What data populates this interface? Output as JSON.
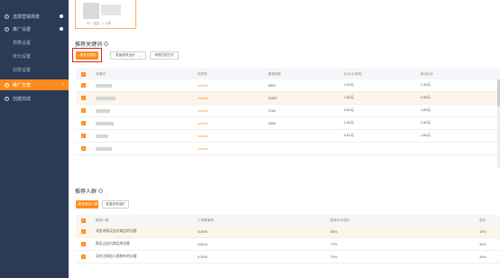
{
  "sidebar": {
    "items": [
      {
        "num": "1",
        "label": "选择营销场景"
      },
      {
        "num": "2",
        "label": "推广设置"
      },
      {
        "label": "预算设置"
      },
      {
        "label": "单元设置"
      },
      {
        "label": "创意设置"
      },
      {
        "num": "3",
        "label": "推广方案"
      },
      {
        "num": "4",
        "label": "创建完成"
      }
    ]
  },
  "top_card": {
    "caption": "¥0 · 流量 · 1 人群"
  },
  "keywords": {
    "title": "推荐关键词",
    "add_button": "更多关键词",
    "bid_select": "批量修改出价",
    "match_button": "修改匹配方式",
    "columns": [
      "关键词",
      "相关性",
      "展现指数",
      "出价(计算机)",
      "移动出价"
    ],
    "rows": [
      {
        "index": "4552",
        "pc_bid": "1.10元",
        "mobile_bid": "2.44元"
      },
      {
        "index": "11667",
        "pc_bid": "1.52元",
        "mobile_bid": "2.58元"
      },
      {
        "index": "1764",
        "pc_bid": "0.84元",
        "mobile_bid": "1.80元"
      },
      {
        "index": "2366",
        "pc_bid": "1.45元",
        "mobile_bid": "2.82元"
      },
      {
        "index": "-",
        "pc_bid": "0.81元",
        "mobile_bid": "1.84元"
      },
      {
        "index": "",
        "pc_bid": "",
        "mobile_bid": ""
      }
    ]
  },
  "crowd": {
    "title": "推荐人群",
    "add_button": "更多精选人群",
    "batch_button": "批量修改溢价",
    "columns": [
      "精选人群",
      "人群覆盖率",
      "推荐平均溢价",
      "溢价"
    ],
    "rows": [
      {
        "name": "浏览未购买店内商品的访客",
        "coverage": "5.45%",
        "avg_premium": "55%",
        "premium": "10%"
      },
      {
        "name": "购买过店内商品的访客",
        "coverage": "4.81%",
        "avg_premium": "77%",
        "premium": "10%"
      },
      {
        "name": "深关注和加入购物车的访客",
        "coverage": "6.25%",
        "avg_premium": "79%",
        "premium": "10%"
      }
    ]
  },
  "colors": {
    "accent": "#ff8c1a",
    "sidebar_bg": "#2b3a55",
    "highlight": "#e02020"
  }
}
